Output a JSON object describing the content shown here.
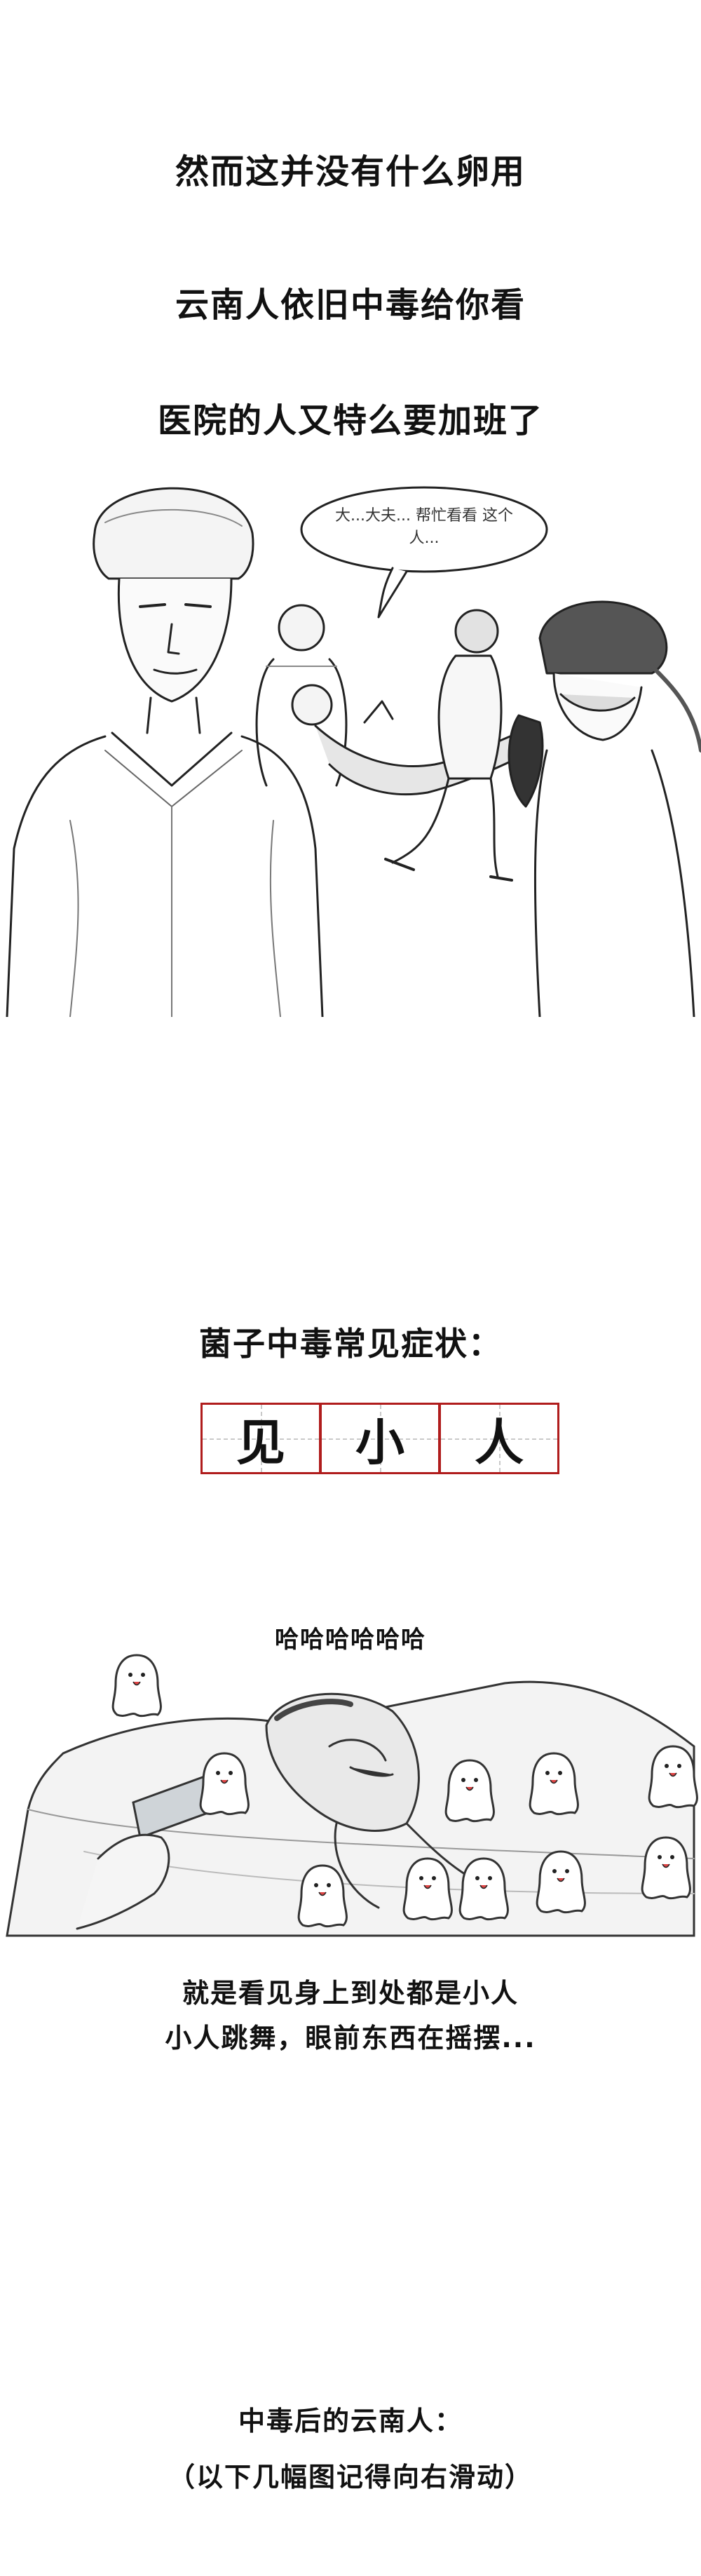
{
  "captions": {
    "line1": "然而这并没有什么卵用",
    "line2": "云南人依旧中毒给你看",
    "line3": "医院的人又特么要加班了",
    "speech": "大...大夫... 帮忙看看 这个人...",
    "symptom_title": "菌子中毒常见症状：",
    "symptom_chars": [
      "见",
      "小",
      "人"
    ],
    "laugh": "哈哈哈哈哈哈",
    "desc_line1": "就是看见身上到处都是小人",
    "desc_line2": "小人跳舞，眼前东西在摇摆...",
    "after_line1": "中毒后的云南人：",
    "after_line2": "（以下几幅图记得向右滑动）"
  }
}
